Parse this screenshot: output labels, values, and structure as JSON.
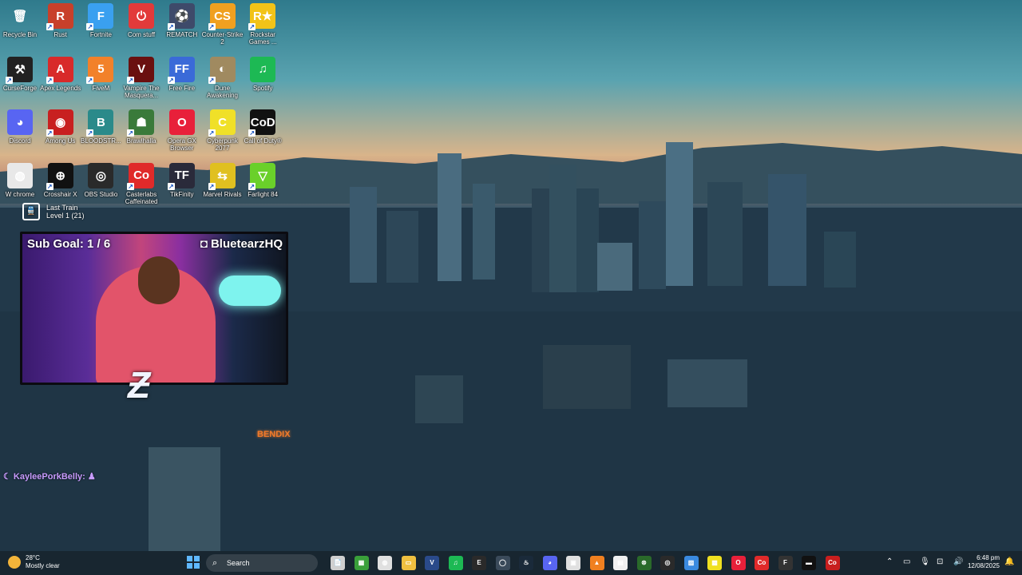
{
  "desktop": {
    "icons": [
      {
        "label": "Recycle Bin",
        "glyph": "🗑",
        "bg": "transparent",
        "shortcut": false
      },
      {
        "label": "Rust",
        "glyph": "R",
        "bg": "#c8402a",
        "shortcut": true
      },
      {
        "label": "Fortnite",
        "glyph": "F",
        "bg": "#3aa0f0",
        "shortcut": true
      },
      {
        "label": "Com stuff",
        "glyph": "⏻",
        "bg": "#e23a3a",
        "shortcut": false
      },
      {
        "label": "REMATCH",
        "glyph": "⚽",
        "bg": "#3e4a6a",
        "shortcut": true
      },
      {
        "label": "Counter-Strike 2",
        "glyph": "CS",
        "bg": "#f0a020",
        "shortcut": true
      },
      {
        "label": "Rockstar Games ...",
        "glyph": "R★",
        "bg": "#f2c318",
        "shortcut": true
      },
      {
        "label": "CurseForge",
        "glyph": "⚒",
        "bg": "#222",
        "shortcut": true
      },
      {
        "label": "Apex Legends",
        "glyph": "A",
        "bg": "#d82a2a",
        "shortcut": true
      },
      {
        "label": "FiveM",
        "glyph": "5",
        "bg": "#f2812a",
        "shortcut": true
      },
      {
        "label": "Vampire The Masquera...",
        "glyph": "V",
        "bg": "#6a1010",
        "shortcut": true
      },
      {
        "label": "Free Fire",
        "glyph": "FF",
        "bg": "#3a6ad8",
        "shortcut": true
      },
      {
        "label": "Dune Awakening",
        "glyph": "◐",
        "bg": "#a08a60",
        "shortcut": true
      },
      {
        "label": "Spotify",
        "glyph": "♫",
        "bg": "#1db954",
        "shortcut": false
      },
      {
        "label": "Discord",
        "glyph": "◕",
        "bg": "#5865f2",
        "shortcut": false
      },
      {
        "label": "Among Us",
        "glyph": "◉",
        "bg": "#c82020",
        "shortcut": true
      },
      {
        "label": "BLOODSTR...",
        "glyph": "B",
        "bg": "#2a8a8a",
        "shortcut": true
      },
      {
        "label": "Brawlhalla",
        "glyph": "☗",
        "bg": "#3a7a3a",
        "shortcut": true
      },
      {
        "label": "Opera GX Browser",
        "glyph": "O",
        "bg": "#e8203a",
        "shortcut": false
      },
      {
        "label": "Cyberpunk 2077",
        "glyph": "C",
        "bg": "#f0e028",
        "shortcut": true
      },
      {
        "label": "Call of Duty®",
        "glyph": "CoD",
        "bg": "#111",
        "shortcut": true
      },
      {
        "label": "W chrome",
        "glyph": "◍",
        "bg": "#e8e8e8",
        "shortcut": false
      },
      {
        "label": "Crosshair X",
        "glyph": "⊕",
        "bg": "#111",
        "shortcut": true
      },
      {
        "label": "OBS Studio",
        "glyph": "◎",
        "bg": "#2a2a2a",
        "shortcut": false
      },
      {
        "label": "Casterlabs Caffeinated",
        "glyph": "Co",
        "bg": "#e02a2a",
        "shortcut": true
      },
      {
        "label": "TikFinity",
        "glyph": "TF",
        "bg": "#2a2a3a",
        "shortcut": true
      },
      {
        "label": "Marvel Rivals",
        "glyph": "⇆",
        "bg": "#e0c020",
        "shortcut": true
      },
      {
        "label": "Farlight 84",
        "glyph": "▽",
        "bg": "#6ad02a",
        "shortcut": true
      }
    ]
  },
  "widget": {
    "title": "Last Train",
    "level": "Level 1 (21)",
    "glyph": "🚆"
  },
  "overlay": {
    "sub_goal": "Sub Goal: 1 / 6",
    "handle": "BluetearzHQ",
    "chat_user": "KayleePorkBelly:",
    "sign": "BENDIX"
  },
  "taskbar": {
    "weather_temp": "28°C",
    "weather_desc": "Mostly clear",
    "search_placeholder": "Search",
    "search_icon": "search-icon",
    "apps": [
      {
        "name": "file-explorer",
        "glyph": "📄",
        "bg": "#cfcfcf"
      },
      {
        "name": "minecraft",
        "glyph": "▦",
        "bg": "#3aa03a"
      },
      {
        "name": "chrome",
        "glyph": "◍",
        "bg": "#e0e0e0"
      },
      {
        "name": "folder",
        "glyph": "▭",
        "bg": "#f0c040"
      },
      {
        "name": "visual-studio",
        "glyph": "V",
        "bg": "#2a4a8a"
      },
      {
        "name": "spotify",
        "glyph": "♫",
        "bg": "#1db954"
      },
      {
        "name": "epic-games",
        "glyph": "E",
        "bg": "#2a2a2a"
      },
      {
        "name": "steam-circle",
        "glyph": "◯",
        "bg": "#3a4a5a"
      },
      {
        "name": "steam",
        "glyph": "♨",
        "bg": "#1a2a3a"
      },
      {
        "name": "discord",
        "glyph": "◕",
        "bg": "#5865f2"
      },
      {
        "name": "qr-app",
        "glyph": "▣",
        "bg": "#e0e0e0"
      },
      {
        "name": "vlc",
        "glyph": "▲",
        "bg": "#f08020"
      },
      {
        "name": "notepad",
        "glyph": "▤",
        "bg": "#f0f0f0"
      },
      {
        "name": "xbox",
        "glyph": "⊗",
        "bg": "#2a6a2a"
      },
      {
        "name": "obs",
        "glyph": "◎",
        "bg": "#2a2a2a"
      },
      {
        "name": "photos",
        "glyph": "▨",
        "bg": "#3a8ae0"
      },
      {
        "name": "sticky-notes",
        "glyph": "▩",
        "bg": "#f0e020"
      },
      {
        "name": "opera-gx",
        "glyph": "O",
        "bg": "#e8203a"
      },
      {
        "name": "casterlabs",
        "glyph": "Co",
        "bg": "#e02a2a"
      },
      {
        "name": "fivem",
        "glyph": "F",
        "bg": "#333"
      },
      {
        "name": "terminal",
        "glyph": "▬",
        "bg": "#111"
      },
      {
        "name": "casterlabs-active",
        "glyph": "Co",
        "bg": "#c81e1e"
      }
    ],
    "tray_glyphs": [
      "⌃",
      "▭",
      "🎙",
      "⊡",
      "🔊"
    ],
    "time": "6:48 pm",
    "date": "12/08/2025",
    "bell": "🔔"
  }
}
